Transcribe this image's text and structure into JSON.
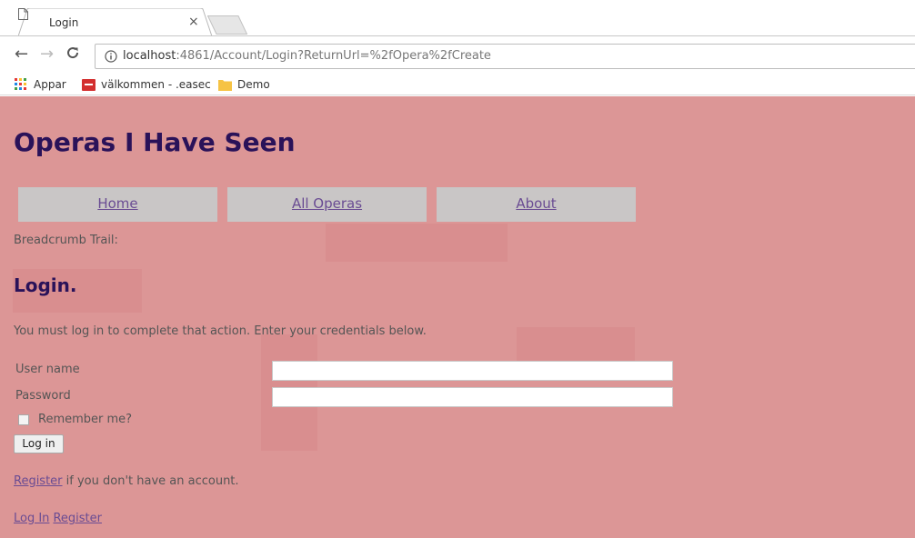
{
  "browser": {
    "tab_title": "Login",
    "tab_close": "×",
    "url_host": "localhost",
    "url_rest": ":4861/Account/Login?ReturnUrl=%2fOpera%2fCreate",
    "bookmarks": [
      {
        "label": "Appar",
        "icon": "apps-grid-icon"
      },
      {
        "label": "välkommen - .easec",
        "icon": "red-site-icon"
      },
      {
        "label": "Demo",
        "icon": "folder-icon"
      }
    ],
    "icons": {
      "back": "←",
      "forward": "→",
      "reload": "C"
    }
  },
  "colors": {
    "page_background": "#dc9696",
    "title_color": "#2a1259",
    "link_color": "#6a4c93",
    "nav_background": "#c9c6c6"
  },
  "site": {
    "title": "Operas I Have Seen",
    "nav": [
      {
        "label": "Home"
      },
      {
        "label": "All Operas"
      },
      {
        "label": "About"
      }
    ],
    "breadcrumb": "Breadcrumb Trail:"
  },
  "login": {
    "heading": "Login.",
    "message": "You must log in to complete that action. Enter your credentials below.",
    "username_label": "User name",
    "username_value": "",
    "password_label": "Password",
    "password_value": "",
    "remember_label": "Remember me?",
    "remember_checked": false,
    "submit_label": "Log in",
    "register_link": "Register",
    "register_suffix": " if you don't have an account."
  },
  "footer": {
    "login_link": "Log In",
    "register_link": "Register"
  }
}
